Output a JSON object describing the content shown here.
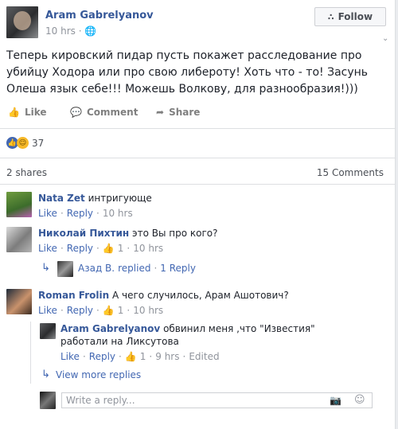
{
  "post": {
    "author": "Aram Gabrelyanov",
    "time": "10 hrs",
    "follow_label": "Follow",
    "text": "Теперь кировский пидар пусть покажет расследование про убийцу Ходора или про свою либероту! Хоть что - то! Засунь Олеша язык себе!!! Можешь Волкову, для разнообразия!)))",
    "actions": {
      "like": "Like",
      "comment": "Comment",
      "share": "Share"
    },
    "reactions_count": "37",
    "shares": "2 shares",
    "comments_count": "15 Comments"
  },
  "comments": [
    {
      "name": "Nata Zet",
      "text": "интригующе",
      "like": "Like",
      "reply": "Reply",
      "time": "10 hrs"
    },
    {
      "name": "Николай Пихтин",
      "text": "это Вы про кого?",
      "like": "Like",
      "reply": "Reply",
      "likes": "1",
      "time": "10 hrs",
      "replied": {
        "name": "Азад В.",
        "action": "replied",
        "count": "1 Reply"
      }
    },
    {
      "name": "Roman Frolin",
      "text": "А чего случилось, Арам Ашотович?",
      "like": "Like",
      "reply": "Reply",
      "likes": "1",
      "time": "10 hrs",
      "reply_item": {
        "name": "Aram Gabrelyanov",
        "text": "обвинил меня ,что \"Известия\" работали на Ликсутова",
        "like": "Like",
        "reply": "Reply",
        "likes": "1",
        "time": "9 hrs",
        "edited": "Edited"
      },
      "view_more": "View more replies"
    }
  ],
  "reply_box": {
    "placeholder": "Write a reply..."
  },
  "colors": {
    "link": "#365899",
    "accent": "#4267b2",
    "muted": "#90949c"
  },
  "icons": [
    "follow-rss-icon",
    "globe-icon",
    "chevron-down-icon",
    "like-icon",
    "comment-icon",
    "share-icon",
    "like-reaction-icon",
    "haha-reaction-icon",
    "thumb-icon",
    "reply-arrow-icon",
    "camera-icon",
    "emoji-icon"
  ]
}
